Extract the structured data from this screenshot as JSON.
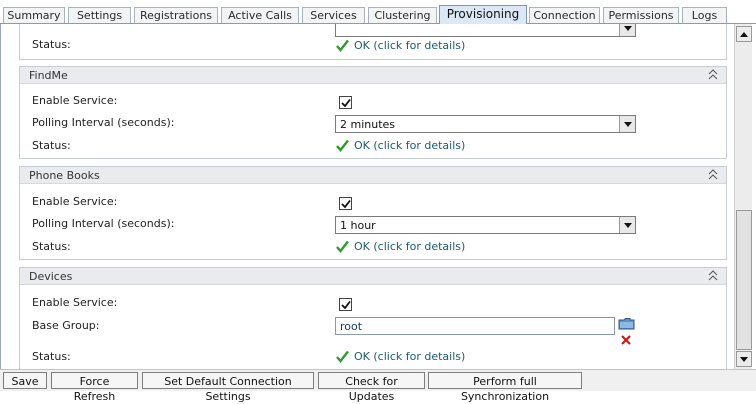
{
  "tabs": [
    {
      "label": "Summary"
    },
    {
      "label": "Settings"
    },
    {
      "label": "Registrations"
    },
    {
      "label": "Active Calls"
    },
    {
      "label": "Services"
    },
    {
      "label": "Clustering"
    },
    {
      "label": "Provisioning",
      "active": true
    },
    {
      "label": "Connection"
    },
    {
      "label": "Permissions"
    },
    {
      "label": "Logs"
    }
  ],
  "top_partial": {
    "status_label": "Status:",
    "status_text": "OK (click for details)"
  },
  "findme": {
    "title": "FindMe",
    "enable_label": "Enable Service:",
    "enabled": true,
    "polling_label": "Polling Interval (seconds):",
    "polling_value": "2 minutes",
    "status_label": "Status:",
    "status_text": "OK (click for details)"
  },
  "phonebooks": {
    "title": "Phone Books",
    "enable_label": "Enable Service:",
    "enabled": true,
    "polling_label": "Polling Interval (seconds):",
    "polling_value": "1 hour",
    "status_label": "Status:",
    "status_text": "OK (click for details)"
  },
  "devices": {
    "title": "Devices",
    "enable_label": "Enable Service:",
    "enabled": true,
    "base_group_label": "Base Group:",
    "base_group_value": "root",
    "status_label": "Status:",
    "status_text": "OK (click for details)"
  },
  "buttons": {
    "save": "Save",
    "force_refresh": "Force Refresh",
    "set_default": "Set Default Connection Settings",
    "check_updates": "Check for Updates",
    "full_sync": "Perform full Synchronization"
  },
  "colors": {
    "status_ok": "#1d5b6e",
    "check_green": "#2f9a2f",
    "active_tab": "#dce8f6"
  }
}
